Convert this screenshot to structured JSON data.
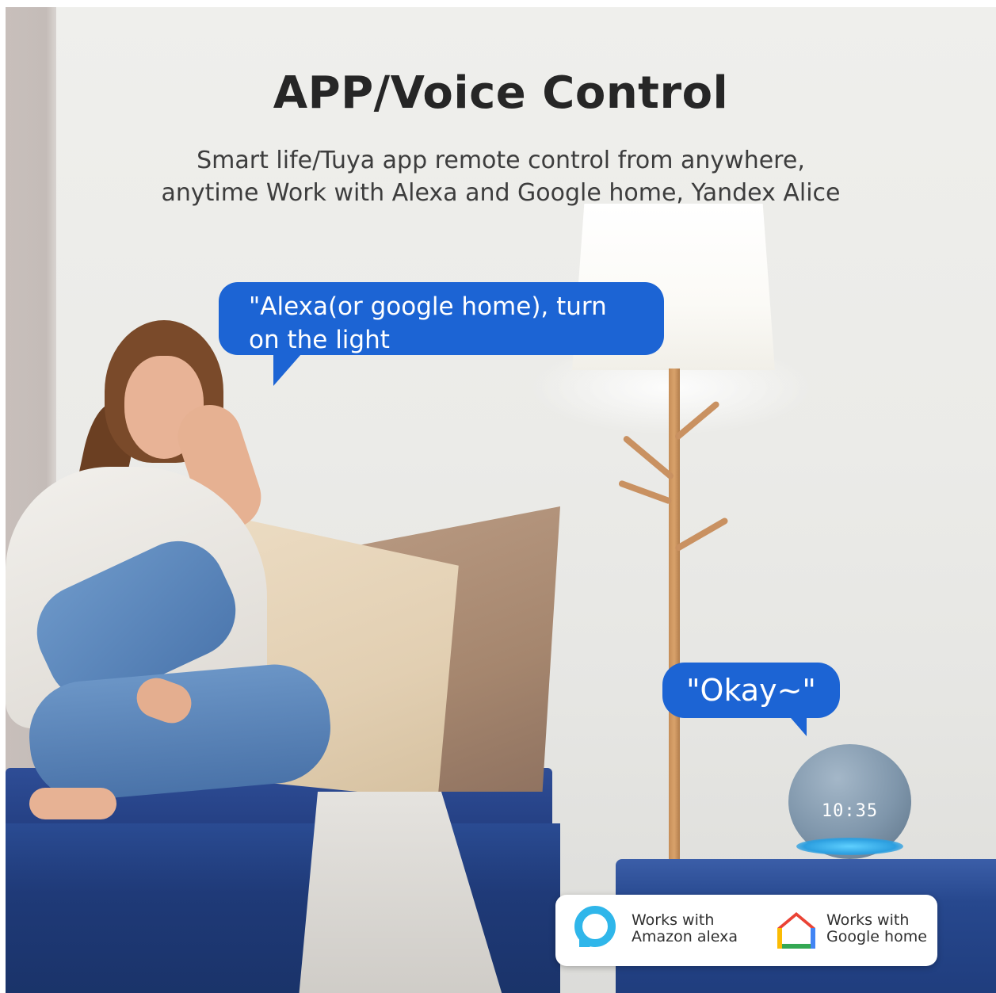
{
  "title": "APP/Voice Control",
  "subtitle_lines": [
    "Smart life/Tuya app remote control from anywhere,",
    "anytime Work with Alexa and Google home, Yandex Alice"
  ],
  "bubbles": {
    "alexa": [
      "\"Alexa(or google home), turn",
      "on the light"
    ],
    "okay": "\"Okay~\""
  },
  "speaker_time": "10:35",
  "badges": {
    "alexa": [
      "Works with",
      "Amazon alexa"
    ],
    "google": [
      "Works with",
      "Google home"
    ]
  },
  "colors": {
    "bubble_blue": "#1c64d4",
    "alexa_cyan": "#2fb6ea",
    "google_red": "#ea4335",
    "google_yellow": "#fbbc04",
    "google_green": "#34a853",
    "google_blue": "#4285f4"
  },
  "icons": [
    "alexa-logo-icon",
    "google-home-logo-icon"
  ]
}
